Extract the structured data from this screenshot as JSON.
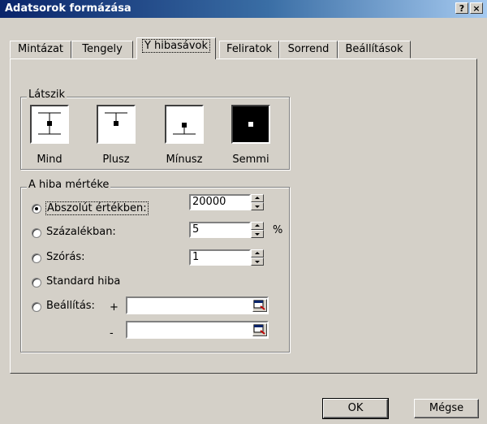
{
  "window": {
    "title": "Adatsorok formázása",
    "help_label": "?",
    "close_label": "×"
  },
  "tabs": [
    {
      "label": "Mintázat"
    },
    {
      "label": "Tengely"
    },
    {
      "label": "Y hibasávok",
      "active": true
    },
    {
      "label": "Feliratok"
    },
    {
      "label": "Sorrend"
    },
    {
      "label": "Beállítások"
    }
  ],
  "display": {
    "legend": "Látszik",
    "options": [
      {
        "label": "Mind",
        "icon": "error-bar-both-icon"
      },
      {
        "label": "Plusz",
        "icon": "error-bar-plus-icon"
      },
      {
        "label": "Mínusz",
        "icon": "error-bar-minus-icon"
      },
      {
        "label": "Semmi",
        "icon": "error-bar-none-icon",
        "selected": true
      }
    ]
  },
  "amount": {
    "legend": "A hiba mértéke",
    "fixed": {
      "label": "Abszolút értékben:",
      "value": "20000",
      "selected": true
    },
    "percent": {
      "label": "Százalékban:",
      "value": "5",
      "unit": "%"
    },
    "stddev": {
      "label": "Szórás:",
      "value": "1"
    },
    "stderr": {
      "label": "Standard hiba"
    },
    "custom": {
      "label": "Beállítás:",
      "plus_sign": "+",
      "minus_sign": "-",
      "plus_value": "",
      "minus_value": ""
    }
  },
  "buttons": {
    "ok": "OK",
    "cancel": "Mégse"
  },
  "colors": {
    "dialog_bg": "#d4d0c8",
    "title_active": "#0a246a"
  }
}
